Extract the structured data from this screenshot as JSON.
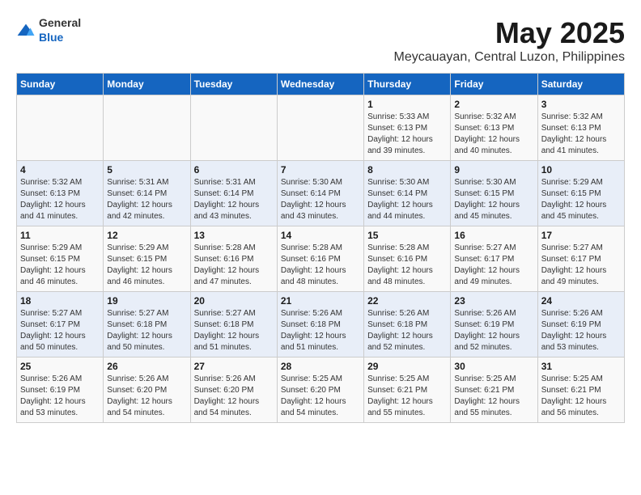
{
  "logo": {
    "text_general": "General",
    "text_blue": "Blue"
  },
  "title": "May 2025",
  "subtitle": "Meycauayan, Central Luzon, Philippines",
  "days_of_week": [
    "Sunday",
    "Monday",
    "Tuesday",
    "Wednesday",
    "Thursday",
    "Friday",
    "Saturday"
  ],
  "weeks": [
    [
      {
        "day": "",
        "info": ""
      },
      {
        "day": "",
        "info": ""
      },
      {
        "day": "",
        "info": ""
      },
      {
        "day": "",
        "info": ""
      },
      {
        "day": "1",
        "info": "Sunrise: 5:33 AM\nSunset: 6:13 PM\nDaylight: 12 hours and 39 minutes."
      },
      {
        "day": "2",
        "info": "Sunrise: 5:32 AM\nSunset: 6:13 PM\nDaylight: 12 hours and 40 minutes."
      },
      {
        "day": "3",
        "info": "Sunrise: 5:32 AM\nSunset: 6:13 PM\nDaylight: 12 hours and 41 minutes."
      }
    ],
    [
      {
        "day": "4",
        "info": "Sunrise: 5:32 AM\nSunset: 6:13 PM\nDaylight: 12 hours and 41 minutes."
      },
      {
        "day": "5",
        "info": "Sunrise: 5:31 AM\nSunset: 6:14 PM\nDaylight: 12 hours and 42 minutes."
      },
      {
        "day": "6",
        "info": "Sunrise: 5:31 AM\nSunset: 6:14 PM\nDaylight: 12 hours and 43 minutes."
      },
      {
        "day": "7",
        "info": "Sunrise: 5:30 AM\nSunset: 6:14 PM\nDaylight: 12 hours and 43 minutes."
      },
      {
        "day": "8",
        "info": "Sunrise: 5:30 AM\nSunset: 6:14 PM\nDaylight: 12 hours and 44 minutes."
      },
      {
        "day": "9",
        "info": "Sunrise: 5:30 AM\nSunset: 6:15 PM\nDaylight: 12 hours and 45 minutes."
      },
      {
        "day": "10",
        "info": "Sunrise: 5:29 AM\nSunset: 6:15 PM\nDaylight: 12 hours and 45 minutes."
      }
    ],
    [
      {
        "day": "11",
        "info": "Sunrise: 5:29 AM\nSunset: 6:15 PM\nDaylight: 12 hours and 46 minutes."
      },
      {
        "day": "12",
        "info": "Sunrise: 5:29 AM\nSunset: 6:15 PM\nDaylight: 12 hours and 46 minutes."
      },
      {
        "day": "13",
        "info": "Sunrise: 5:28 AM\nSunset: 6:16 PM\nDaylight: 12 hours and 47 minutes."
      },
      {
        "day": "14",
        "info": "Sunrise: 5:28 AM\nSunset: 6:16 PM\nDaylight: 12 hours and 48 minutes."
      },
      {
        "day": "15",
        "info": "Sunrise: 5:28 AM\nSunset: 6:16 PM\nDaylight: 12 hours and 48 minutes."
      },
      {
        "day": "16",
        "info": "Sunrise: 5:27 AM\nSunset: 6:17 PM\nDaylight: 12 hours and 49 minutes."
      },
      {
        "day": "17",
        "info": "Sunrise: 5:27 AM\nSunset: 6:17 PM\nDaylight: 12 hours and 49 minutes."
      }
    ],
    [
      {
        "day": "18",
        "info": "Sunrise: 5:27 AM\nSunset: 6:17 PM\nDaylight: 12 hours and 50 minutes."
      },
      {
        "day": "19",
        "info": "Sunrise: 5:27 AM\nSunset: 6:18 PM\nDaylight: 12 hours and 50 minutes."
      },
      {
        "day": "20",
        "info": "Sunrise: 5:27 AM\nSunset: 6:18 PM\nDaylight: 12 hours and 51 minutes."
      },
      {
        "day": "21",
        "info": "Sunrise: 5:26 AM\nSunset: 6:18 PM\nDaylight: 12 hours and 51 minutes."
      },
      {
        "day": "22",
        "info": "Sunrise: 5:26 AM\nSunset: 6:18 PM\nDaylight: 12 hours and 52 minutes."
      },
      {
        "day": "23",
        "info": "Sunrise: 5:26 AM\nSunset: 6:19 PM\nDaylight: 12 hours and 52 minutes."
      },
      {
        "day": "24",
        "info": "Sunrise: 5:26 AM\nSunset: 6:19 PM\nDaylight: 12 hours and 53 minutes."
      }
    ],
    [
      {
        "day": "25",
        "info": "Sunrise: 5:26 AM\nSunset: 6:19 PM\nDaylight: 12 hours and 53 minutes."
      },
      {
        "day": "26",
        "info": "Sunrise: 5:26 AM\nSunset: 6:20 PM\nDaylight: 12 hours and 54 minutes."
      },
      {
        "day": "27",
        "info": "Sunrise: 5:26 AM\nSunset: 6:20 PM\nDaylight: 12 hours and 54 minutes."
      },
      {
        "day": "28",
        "info": "Sunrise: 5:25 AM\nSunset: 6:20 PM\nDaylight: 12 hours and 54 minutes."
      },
      {
        "day": "29",
        "info": "Sunrise: 5:25 AM\nSunset: 6:21 PM\nDaylight: 12 hours and 55 minutes."
      },
      {
        "day": "30",
        "info": "Sunrise: 5:25 AM\nSunset: 6:21 PM\nDaylight: 12 hours and 55 minutes."
      },
      {
        "day": "31",
        "info": "Sunrise: 5:25 AM\nSunset: 6:21 PM\nDaylight: 12 hours and 56 minutes."
      }
    ]
  ]
}
